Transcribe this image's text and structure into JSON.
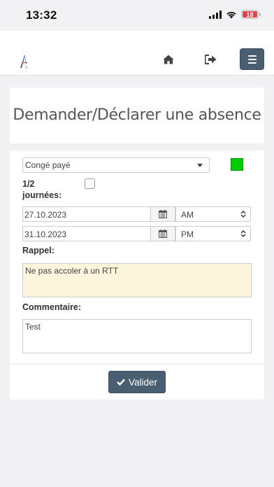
{
  "status_bar": {
    "time": "13:32",
    "battery": "18"
  },
  "nav": {
    "home_icon": "home-icon",
    "logout_icon": "sign-out-icon",
    "menu_icon": "hamburger-icon"
  },
  "page": {
    "title": "Demander/Déclarer une absence"
  },
  "form": {
    "absence_type": {
      "selected": "Congé payé",
      "color": "#00cc00"
    },
    "half_day_label": "1/2 journées:",
    "start": {
      "date": "27.10.2023",
      "period": "AM"
    },
    "end": {
      "date": "31.10.2023",
      "period": "PM"
    },
    "reminder_label": "Rappel:",
    "reminder_text": "Ne pas accoler à un RTT",
    "comment_label": "Commentaire:",
    "comment_text": "Test"
  },
  "actions": {
    "validate_label": "Valider"
  },
  "colors": {
    "accent": "#4a5e72",
    "reminder_bg": "#fcf4dd"
  }
}
